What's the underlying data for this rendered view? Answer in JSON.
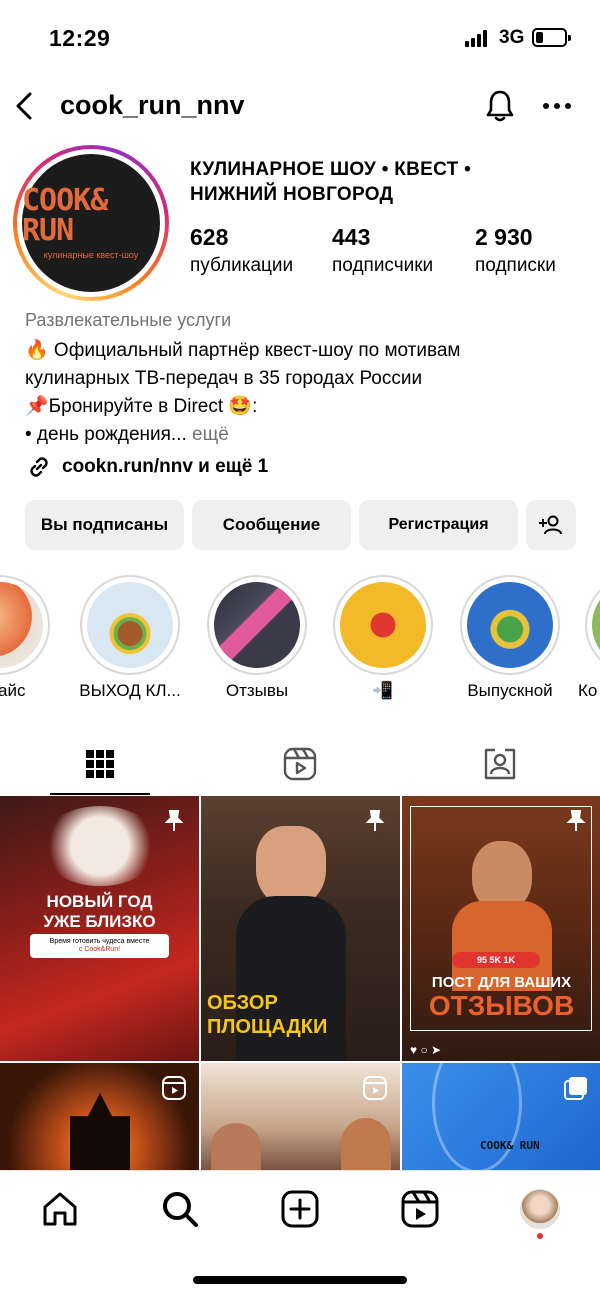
{
  "status_bar": {
    "time": "12:29",
    "network": "3G"
  },
  "header": {
    "username": "cook_run_nnv"
  },
  "profile": {
    "logo_text": "COOK& RUN",
    "logo_sub": "кулинарные квест-шоу",
    "title_line1": "КУЛИНАРНОЕ ШОУ • КВЕСТ •",
    "title_line2": "НИЖНИЙ НОВГОРОД",
    "stats": [
      {
        "num": "628",
        "label": "публикации"
      },
      {
        "num": "443",
        "label": "подписчики"
      },
      {
        "num": "2 930",
        "label": "подписки"
      }
    ],
    "category": "Развлекательные услуги",
    "bio_line1": "🔥 Официальный партнёр квест-шоу по мотивам",
    "bio_line2": "кулинарных ТВ-передач в 35 городах России",
    "bio_line3": "📌Бронируйте в Direct 🤩:",
    "bio_line4": "• день рождения...",
    "bio_more": " ещё",
    "link": "cookn.run/nnv и ещё 1"
  },
  "buttons": {
    "subscribed": "Вы подписаны",
    "message": "Сообщение",
    "register": "Регистрация"
  },
  "highlights": [
    {
      "label": "айс"
    },
    {
      "label": "ВЫХОД КЛ..."
    },
    {
      "label": "Отзывы"
    },
    {
      "label": "📲"
    },
    {
      "label": "Выпускной"
    },
    {
      "label": "Ко"
    }
  ],
  "posts": [
    {
      "line1": "НОВЫЙ ГОД",
      "line2": "УЖЕ БЛИЗКО",
      "sub1": "Время готовить чудеса вместе",
      "sub2": "с Cook&Run!"
    },
    {
      "line1": "ОБЗОР",
      "line2": "ПЛОЩАДКИ"
    },
    {
      "line1": "ПОСТ ДЛЯ ВАШИХ",
      "line2": "ОТЗЫВОВ",
      "stats": "95  5K  1K"
    },
    {},
    {},
    {
      "logo": "COOK& RUN"
    }
  ],
  "colors": {
    "brand_orange": "#e36a3a",
    "logo_bg": "#1c1c1c",
    "button_bg": "#efefef",
    "muted": "#737373"
  }
}
